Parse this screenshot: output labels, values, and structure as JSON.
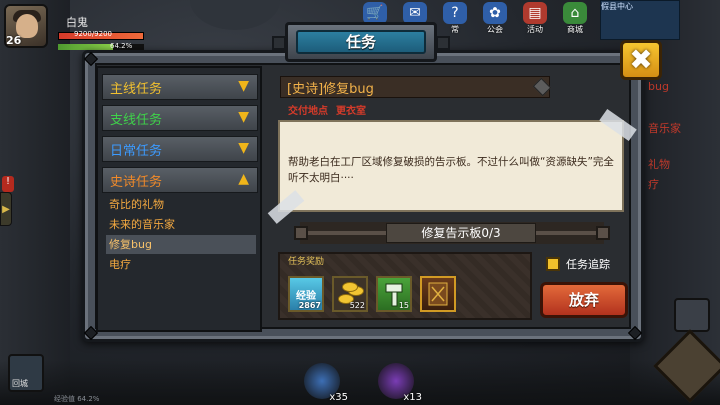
{
  "player": {
    "name": "白鬼",
    "level": "26",
    "hp_text": "9200/9200",
    "hp_fraction": 1.0,
    "exp_text": "64.2%",
    "exp_fraction": 0.642
  },
  "top_menu": [
    {
      "label": "",
      "icon": "shop-cart-icon"
    },
    {
      "label": "",
      "icon": "gift-icon"
    },
    {
      "label": "常",
      "icon": "daily-icon"
    },
    {
      "label": "公会",
      "icon": "guild-icon"
    },
    {
      "label": "活动",
      "icon": "event-icon"
    },
    {
      "label": "商城",
      "icon": "mall-icon"
    }
  ],
  "minimap_label": "假县中心",
  "dialog": {
    "title": "任务",
    "categories": [
      {
        "label": "主线任务",
        "color": "#f0c030",
        "expanded": false
      },
      {
        "label": "支线任务",
        "color": "#3fd24a",
        "expanded": false
      },
      {
        "label": "日常任务",
        "color": "#3c9bff",
        "expanded": false
      },
      {
        "label": "史诗任务",
        "color": "#f08a2a",
        "expanded": true
      }
    ],
    "epic_quests": [
      "奇比的礼物",
      "未来的音乐家",
      "修复bug",
      "电疗"
    ],
    "selected_quest": "[史诗]修复bug",
    "deliver_label": "交付地点",
    "deliver_value": "更衣室",
    "description": "帮助老白在工厂区域修复破损的告示板。不过什么叫做“资源缺失”完全听不太明白····",
    "progress_text": "修复告示板0/3",
    "reward_label": "任务奖励",
    "rewards": [
      {
        "name": "exp",
        "label": "经验",
        "count": "2867"
      },
      {
        "name": "coins",
        "label": "",
        "count": "522"
      },
      {
        "name": "hammer",
        "label": "",
        "count": "15"
      },
      {
        "name": "book",
        "label": "",
        "count": ""
      }
    ],
    "track_label": "任务追踪",
    "track_checked": true,
    "abandon_label": "放弃",
    "close_label": "✖"
  },
  "side_peek": [
    "bug",
    "音乐家",
    "礼物",
    "疗"
  ],
  "side_left_label": "回城",
  "skills": [
    {
      "count": "x35",
      "color": "#3d6fb5"
    },
    {
      "count": "x13",
      "color": "#7a3db5"
    }
  ],
  "bottom_info": "经验值 64.2%"
}
